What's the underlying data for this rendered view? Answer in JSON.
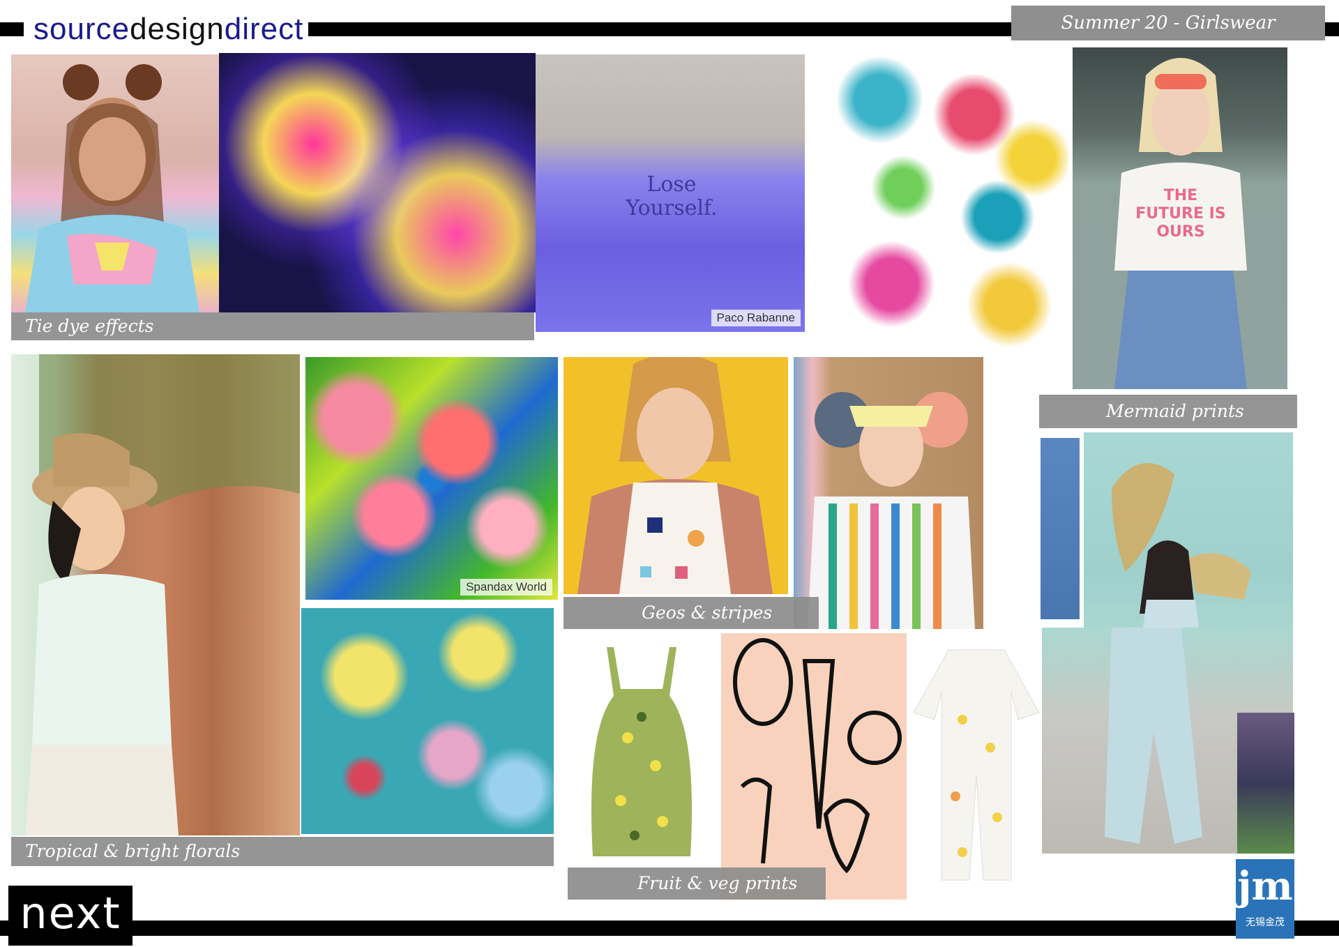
{
  "brand": {
    "part1": "source",
    "part2": "design",
    "part3": "direct"
  },
  "season_title": "Summer 20 - Girlswear",
  "labels": {
    "tie_dye": "Tie dye effects",
    "mermaid": "Mermaid prints",
    "geos": "Geos & stripes",
    "tropical": "Tropical & bright florals",
    "fruit": "Fruit & veg prints"
  },
  "credits": {
    "paco": "Paco Rabanne",
    "spandex": "Spandax World"
  },
  "tshirt_texts": {
    "lose": "Lose Yourself.",
    "future": "THE FUTURE IS OURS"
  },
  "logos": {
    "next": "next",
    "jm_mark": "jm",
    "jm_chinese": "无锡金茂"
  },
  "colors": {
    "label_bg": "#8f8f8f",
    "brand_blue": "#1a1a8c",
    "jm_blue": "#2a73b8"
  }
}
